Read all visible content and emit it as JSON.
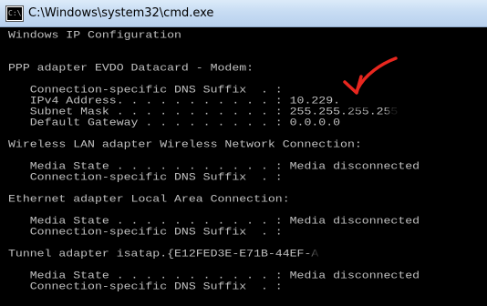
{
  "window": {
    "title": "C:\\Windows\\system32\\cmd.exe",
    "icon_text": "C:\\"
  },
  "console": {
    "lines": [
      "Windows IP Configuration",
      "",
      "",
      "PPP adapter EVDO Datacard - Modem:",
      "",
      "   Connection-specific DNS Suffix  . :",
      "   IPv4 Address. . . . . . . . . . . : 10.229.",
      "   Subnet Mask . . . . . . . . . . . : 255.255.255.255",
      "   Default Gateway . . . . . . . . . : 0.0.0.0",
      "",
      "Wireless LAN adapter Wireless Network Connection:",
      "",
      "   Media State . . . . . . . . . . . : Media disconnected",
      "   Connection-specific DNS Suffix  . :",
      "",
      "Ethernet adapter Local Area Connection:",
      "",
      "   Media State . . . . . . . . . . . : Media disconnected",
      "   Connection-specific DNS Suffix  . :",
      "",
      "Tunnel adapter isatap.{E12FED3E-E71B-44EF-A",
      "",
      "   Media State . . . . . . . . . . . : Media disconnected",
      "   Connection-specific DNS Suffix  . :"
    ]
  },
  "annotation": {
    "arrow_color": "#e8271f",
    "icon": "red-arrow-icon"
  },
  "colors": {
    "console_bg": "#000000",
    "console_fg": "#c0c0c0"
  }
}
